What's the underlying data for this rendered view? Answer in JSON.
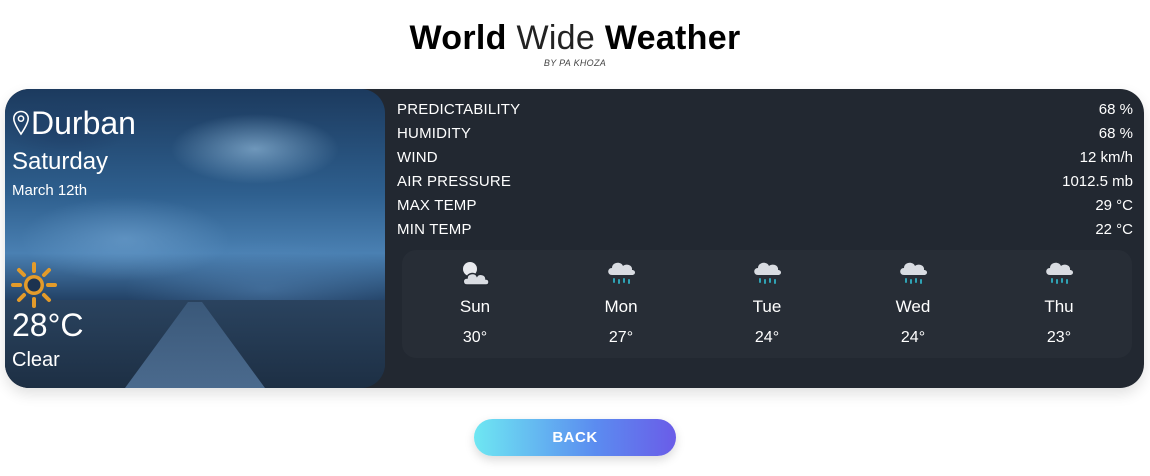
{
  "header": {
    "title_part1": "World",
    "title_part2": "Wide",
    "title_part3": "Weather",
    "byline": "BY PA KHOZA"
  },
  "current": {
    "city": "Durban",
    "day": "Saturday",
    "date": "March 12th",
    "temperature": "28°C",
    "condition": "Clear",
    "condition_icon": "sun-icon",
    "location_icon": "map-pin-icon"
  },
  "details": [
    {
      "label": "PREDICTABILITY",
      "value": "68 %"
    },
    {
      "label": "HUMIDITY",
      "value": "68 %"
    },
    {
      "label": "WIND",
      "value": "12 km/h"
    },
    {
      "label": "AIR PRESSURE",
      "value": "1012.5 mb"
    },
    {
      "label": "MAX TEMP",
      "value": "29 °C"
    },
    {
      "label": "MIN TEMP",
      "value": "22 °C"
    }
  ],
  "forecast": [
    {
      "day": "Sun",
      "temp": "30°",
      "icon": "partly-cloudy-icon"
    },
    {
      "day": "Mon",
      "temp": "27°",
      "icon": "rain-cloud-icon"
    },
    {
      "day": "Tue",
      "temp": "24°",
      "icon": "rain-cloud-icon"
    },
    {
      "day": "Wed",
      "temp": "24°",
      "icon": "rain-cloud-icon"
    },
    {
      "day": "Thu",
      "temp": "23°",
      "icon": "rain-cloud-icon"
    }
  ],
  "back_button": {
    "label": "BACK"
  },
  "colors": {
    "card_bg": "#222831",
    "sun": "#e39b2a",
    "rain": "#2fa3b5",
    "button_start": "#6ee7f2",
    "button_end": "#6a5ce8"
  }
}
